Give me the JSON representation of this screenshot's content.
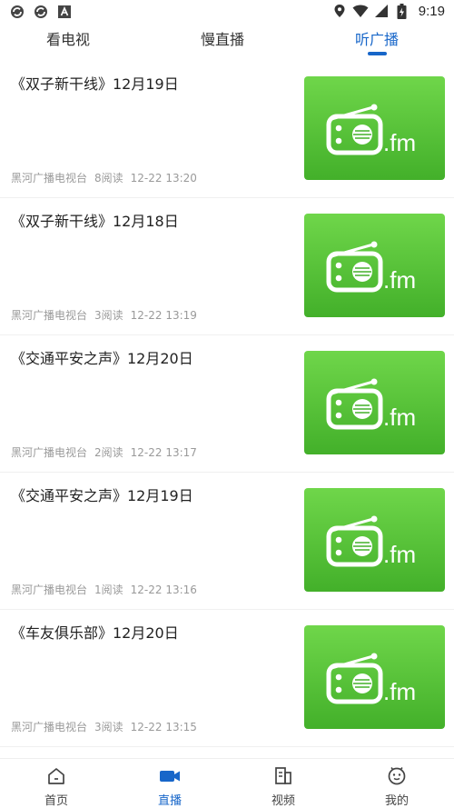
{
  "status_bar": {
    "time": "9:19",
    "icons": [
      "sync-icon",
      "sync-icon",
      "font-a-icon",
      "location-icon",
      "wifi-icon",
      "signal-icon",
      "battery-icon"
    ]
  },
  "top_tabs": [
    {
      "label": "看电视",
      "active": false
    },
    {
      "label": "慢直播",
      "active": false
    },
    {
      "label": "听广播",
      "active": true
    }
  ],
  "accent_color": "#1766c9",
  "thumb_gradient": [
    "#6fd64a",
    "#43b02a"
  ],
  "thumb_caption": ".fm",
  "items": [
    {
      "title": "《双子新干线》12月19日",
      "source": "黑河广播电视台",
      "reads": "8阅读",
      "time": "12-22 13:20"
    },
    {
      "title": "《双子新干线》12月18日",
      "source": "黑河广播电视台",
      "reads": "3阅读",
      "time": "12-22 13:19"
    },
    {
      "title": "《交通平安之声》12月20日",
      "source": "黑河广播电视台",
      "reads": "2阅读",
      "time": "12-22 13:17"
    },
    {
      "title": "《交通平安之声》12月19日",
      "source": "黑河广播电视台",
      "reads": "1阅读",
      "time": "12-22 13:16"
    },
    {
      "title": "《车友俱乐部》12月20日",
      "source": "黑河广播电视台",
      "reads": "3阅读",
      "time": "12-22 13:15"
    }
  ],
  "bottom_nav": [
    {
      "label": "首页",
      "icon": "home-icon",
      "active": false
    },
    {
      "label": "直播",
      "icon": "video-camera-icon",
      "active": true
    },
    {
      "label": "视频",
      "icon": "video-doc-icon",
      "active": false
    },
    {
      "label": "我的",
      "icon": "profile-face-icon",
      "active": false
    }
  ]
}
